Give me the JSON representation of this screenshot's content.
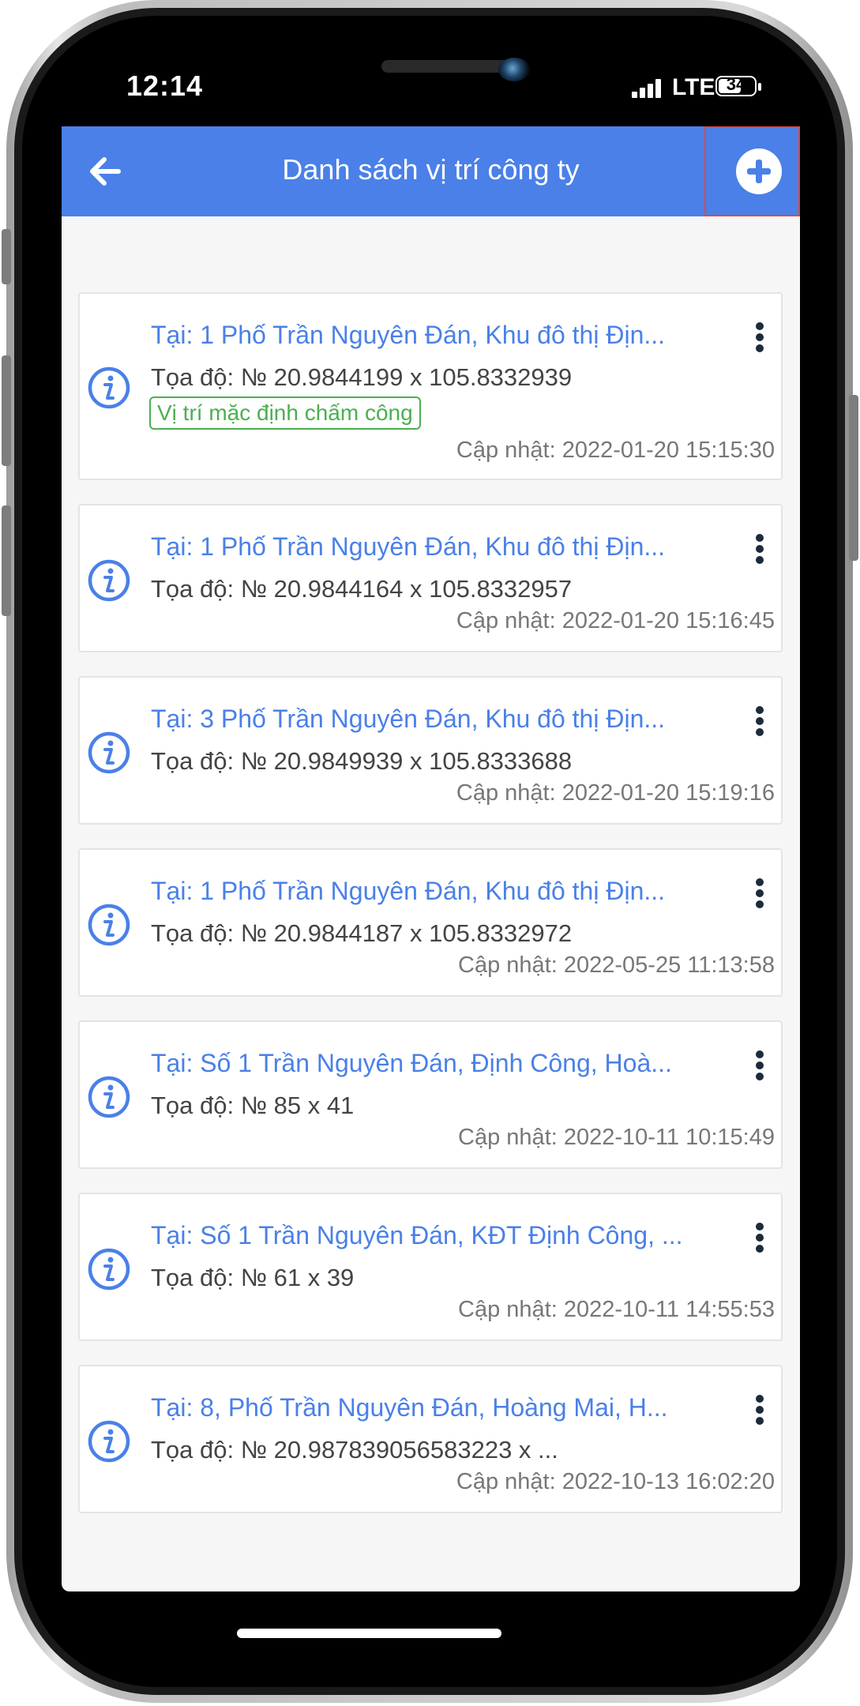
{
  "status_bar": {
    "time": "12:14",
    "network": "LTE",
    "battery": "34"
  },
  "app_bar": {
    "title": "Danh sách vị trí công ty",
    "back_icon": "arrow-left-icon",
    "add_icon": "plus-circle-icon"
  },
  "colors": {
    "primary": "#4a80e8",
    "badge_green": "#4caf50",
    "highlight_red": "#e3473d"
  },
  "locations": [
    {
      "title": "Tại: 1 Phố Trần Nguyên Đán, Khu đô thị Địn...",
      "coord": "Tọa độ: № 20.9844199 x 105.8332939",
      "badge": "Vị trí mặc định chấm công",
      "updated": "Cập nhật: 2022-01-20 15:15:30"
    },
    {
      "title": "Tại: 1 Phố Trần Nguyên Đán, Khu đô thị Địn...",
      "coord": "Tọa độ: № 20.9844164 x 105.8332957",
      "updated": "Cập nhật: 2022-01-20 15:16:45"
    },
    {
      "title": "Tại: 3 Phố Trần Nguyên Đán, Khu đô thị Địn...",
      "coord": "Tọa độ: № 20.9849939 x 105.8333688",
      "updated": "Cập nhật: 2022-01-20 15:19:16"
    },
    {
      "title": "Tại: 1 Phố Trần Nguyên Đán, Khu đô thị Địn...",
      "coord": "Tọa độ: № 20.9844187 x 105.8332972",
      "updated": "Cập nhật: 2022-05-25 11:13:58"
    },
    {
      "title": "Tại: Số 1 Trần Nguyên Đán, Định Công, Hoà...",
      "coord": "Tọa độ: № 85 x 41",
      "updated": "Cập nhật: 2022-10-11 10:15:49"
    },
    {
      "title": "Tại: Số 1 Trần Nguyên Đán, KĐT Định Công, ...",
      "coord": "Tọa độ: № 61 x 39",
      "updated": "Cập nhật: 2022-10-11 14:55:53"
    },
    {
      "title": "Tại: 8, Phố Trần Nguyên Đán, Hoàng Mai, H...",
      "coord": "Tọa độ: № 20.987839056583223 x ...",
      "updated": "Cập nhật: 2022-10-13 16:02:20"
    }
  ]
}
